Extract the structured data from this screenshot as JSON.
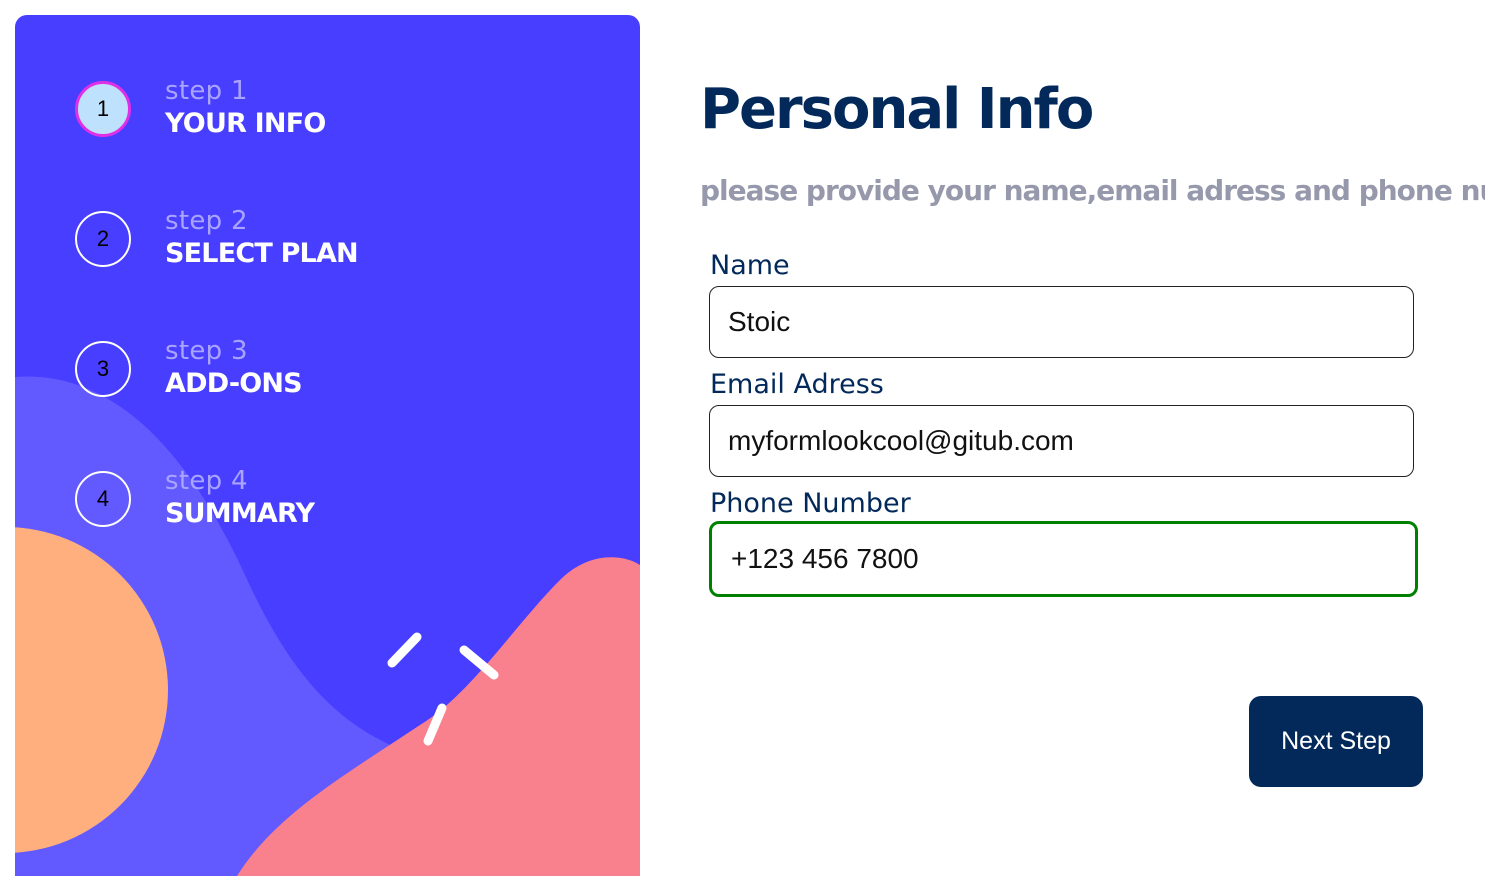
{
  "sidebar": {
    "steps": [
      {
        "number": "1",
        "label": "step 1",
        "title": "YOUR INFO",
        "active": true
      },
      {
        "number": "2",
        "label": "step 2",
        "title": "SELECT PLAN",
        "active": false
      },
      {
        "number": "3",
        "label": "step 3",
        "title": "ADD-ONS",
        "active": false
      },
      {
        "number": "4",
        "label": "step 4",
        "title": "SUMMARY",
        "active": false
      }
    ]
  },
  "main": {
    "title": "Personal Info",
    "subtitle": "please provide your name,email adress and phone number",
    "fields": {
      "name": {
        "label": "Name",
        "value": "Stoic"
      },
      "email": {
        "label": "Email Adress",
        "value": "myformlookcool@gitub.com"
      },
      "phone": {
        "label": "Phone Number",
        "value": "+123 456 7800"
      }
    },
    "next_button_label": "Next Step"
  },
  "colors": {
    "sidebar_bg": "#483eff",
    "active_step_bg": "#bee2fd",
    "active_step_border": "#e030e6",
    "heading": "#02295a",
    "subtitle": "#9699ab",
    "focused_border": "#008000",
    "blob_purple": "#6259ff",
    "blob_orange": "#ffaf7e",
    "blob_pink": "#f9818e"
  }
}
